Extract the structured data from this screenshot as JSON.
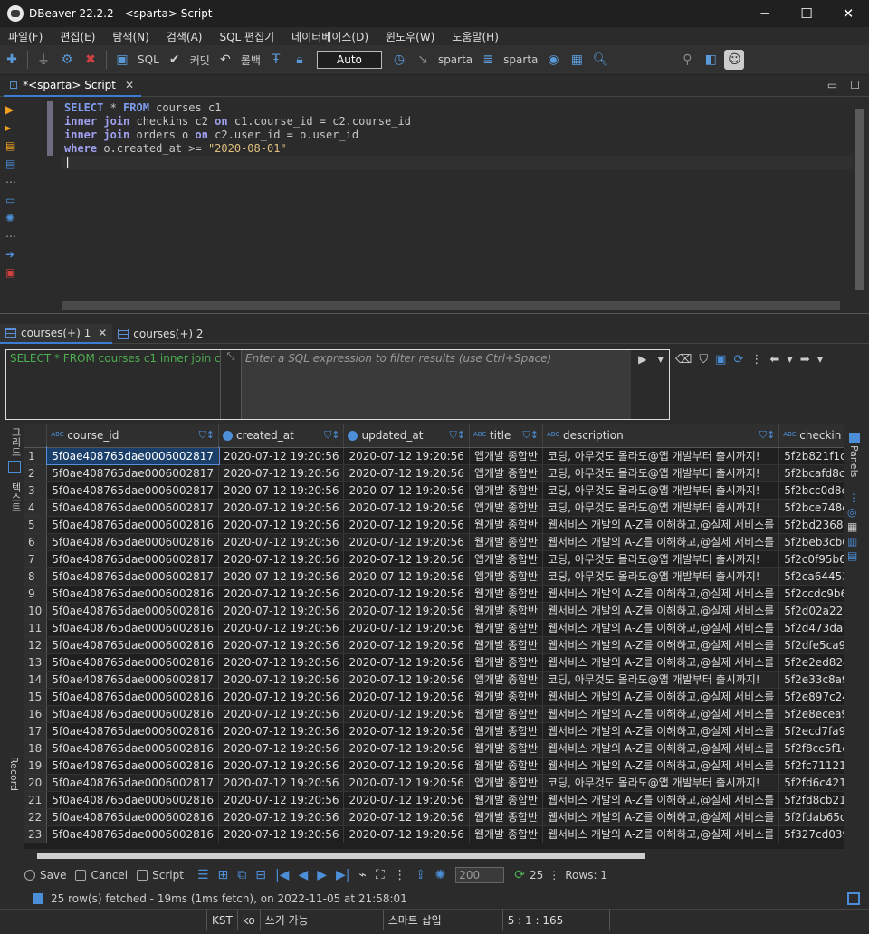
{
  "window": {
    "title": "DBeaver 22.2.2 - <sparta> Script",
    "minimize": "─",
    "maximize": "☐",
    "close": "✕"
  },
  "menu": [
    "파일(F)",
    "편집(E)",
    "탐색(N)",
    "검색(A)",
    "SQL 편집기",
    "데이터베이스(D)",
    "윈도우(W)",
    "도움말(H)"
  ],
  "toolbar": {
    "sql": "SQL",
    "commit": "커밋",
    "rollback": "롤백",
    "auto": "Auto",
    "datasource": "sparta",
    "schema": "sparta"
  },
  "editor_tab": {
    "label": "*<sparta> Script"
  },
  "sql": {
    "line1": [
      "SELECT",
      " * ",
      "FROM",
      " courses c1"
    ],
    "line2": [
      "inner join",
      " checkins c2 ",
      "on",
      " c1.course_id = c2.course_id"
    ],
    "line3": [
      "inner join",
      " orders o ",
      "on",
      " c2.user_id = o.user_id"
    ],
    "line4": [
      "where",
      " o.created_at >= ",
      "\"2020-08-01\""
    ]
  },
  "result_tabs": [
    {
      "label": "courses(+) 1"
    },
    {
      "label": "courses(+) 2"
    }
  ],
  "filter": {
    "query_preview": "SELECT * FROM courses c1 inner join c",
    "placeholder": "Enter a SQL expression to filter results (use Ctrl+Space)"
  },
  "side_left": {
    "grid": "그리드",
    "text": "텍스트",
    "record": "Record"
  },
  "side_right": {
    "panels": "Panels"
  },
  "columns": [
    {
      "name": "course_id",
      "icon": "ABC"
    },
    {
      "name": "created_at",
      "icon": "clock"
    },
    {
      "name": "updated_at",
      "icon": "clock"
    },
    {
      "name": "title",
      "icon": "ABC"
    },
    {
      "name": "description",
      "icon": "ABC"
    },
    {
      "name": "checkin",
      "icon": "ABC"
    }
  ],
  "rows": [
    [
      "1",
      "5f0ae408765dae0006002817",
      "2020-07-12 19:20:56",
      "2020-07-12 19:20:56",
      "앱개발 종합반",
      "코딩, 아무것도 몰라도@앱 개발부터 출시까지!",
      "5f2b821f1c"
    ],
    [
      "2",
      "5f0ae408765dae0006002817",
      "2020-07-12 19:20:56",
      "2020-07-12 19:20:56",
      "앱개발 종합반",
      "코딩, 아무것도 몰라도@앱 개발부터 출시까지!",
      "5f2bcafd8c"
    ],
    [
      "3",
      "5f0ae408765dae0006002817",
      "2020-07-12 19:20:56",
      "2020-07-12 19:20:56",
      "앱개발 종합반",
      "코딩, 아무것도 몰라도@앱 개발부터 출시까지!",
      "5f2bcc0d8c"
    ],
    [
      "4",
      "5f0ae408765dae0006002817",
      "2020-07-12 19:20:56",
      "2020-07-12 19:20:56",
      "앱개발 종합반",
      "코딩, 아무것도 몰라도@앱 개발부터 출시까지!",
      "5f2bce748c"
    ],
    [
      "5",
      "5f0ae408765dae0006002816",
      "2020-07-12 19:20:56",
      "2020-07-12 19:20:56",
      "웹개발 종합반",
      "웹서비스 개발의 A-Z를 이해하고,@실제 서비스를",
      "5f2bd2368c"
    ],
    [
      "6",
      "5f0ae408765dae0006002816",
      "2020-07-12 19:20:56",
      "2020-07-12 19:20:56",
      "웹개발 종합반",
      "웹서비스 개발의 A-Z를 이해하고,@실제 서비스를",
      "5f2beb3cb6"
    ],
    [
      "7",
      "5f0ae408765dae0006002817",
      "2020-07-12 19:20:56",
      "2020-07-12 19:20:56",
      "앱개발 종합반",
      "코딩, 아무것도 몰라도@앱 개발부터 출시까지!",
      "5f2c0f95b6"
    ],
    [
      "8",
      "5f0ae408765dae0006002817",
      "2020-07-12 19:20:56",
      "2020-07-12 19:20:56",
      "앱개발 종합반",
      "코딩, 아무것도 몰라도@앱 개발부터 출시까지!",
      "5f2ca64453"
    ],
    [
      "9",
      "5f0ae408765dae0006002816",
      "2020-07-12 19:20:56",
      "2020-07-12 19:20:56",
      "웹개발 종합반",
      "웹서비스 개발의 A-Z를 이해하고,@실제 서비스를",
      "5f2ccdc9b6"
    ],
    [
      "10",
      "5f0ae408765dae0006002816",
      "2020-07-12 19:20:56",
      "2020-07-12 19:20:56",
      "웹개발 종합반",
      "웹서비스 개발의 A-Z를 이해하고,@실제 서비스를",
      "5f2d02a22a"
    ],
    [
      "11",
      "5f0ae408765dae0006002816",
      "2020-07-12 19:20:56",
      "2020-07-12 19:20:56",
      "웹개발 종합반",
      "웹서비스 개발의 A-Z를 이해하고,@실제 서비스를",
      "5f2d473da9"
    ],
    [
      "12",
      "5f0ae408765dae0006002816",
      "2020-07-12 19:20:56",
      "2020-07-12 19:20:56",
      "웹개발 종합반",
      "웹서비스 개발의 A-Z를 이해하고,@실제 서비스를",
      "5f2dfe5ca9"
    ],
    [
      "13",
      "5f0ae408765dae0006002816",
      "2020-07-12 19:20:56",
      "2020-07-12 19:20:56",
      "웹개발 종합반",
      "웹서비스 개발의 A-Z를 이해하고,@실제 서비스를",
      "5f2e2ed824"
    ],
    [
      "14",
      "5f0ae408765dae0006002817",
      "2020-07-12 19:20:56",
      "2020-07-12 19:20:56",
      "앱개발 종합반",
      "코딩, 아무것도 몰라도@앱 개발부터 출시까지!",
      "5f2e33c8a9"
    ],
    [
      "15",
      "5f0ae408765dae0006002816",
      "2020-07-12 19:20:56",
      "2020-07-12 19:20:56",
      "웹개발 종합반",
      "웹서비스 개발의 A-Z를 이해하고,@실제 서비스를",
      "5f2e897c24"
    ],
    [
      "16",
      "5f0ae408765dae0006002816",
      "2020-07-12 19:20:56",
      "2020-07-12 19:20:56",
      "웹개발 종합반",
      "웹서비스 개발의 A-Z를 이해하고,@실제 서비스를",
      "5f2e8ecea9"
    ],
    [
      "17",
      "5f0ae408765dae0006002816",
      "2020-07-12 19:20:56",
      "2020-07-12 19:20:56",
      "웹개발 종합반",
      "웹서비스 개발의 A-Z를 이해하고,@실제 서비스를",
      "5f2ecd7fa9"
    ],
    [
      "18",
      "5f0ae408765dae0006002816",
      "2020-07-12 19:20:56",
      "2020-07-12 19:20:56",
      "웹개발 종합반",
      "웹서비스 개발의 A-Z를 이해하고,@실제 서비스를",
      "5f2f8cc5f1e"
    ],
    [
      "19",
      "5f0ae408765dae0006002816",
      "2020-07-12 19:20:56",
      "2020-07-12 19:20:56",
      "웹개발 종합반",
      "웹서비스 개발의 A-Z를 이해하고,@실제 서비스를",
      "5f2fc71121"
    ],
    [
      "20",
      "5f0ae408765dae0006002817",
      "2020-07-12 19:20:56",
      "2020-07-12 19:20:56",
      "앱개발 종합반",
      "코딩, 아무것도 몰라도@앱 개발부터 출시까지!",
      "5f2fd6c421"
    ],
    [
      "21",
      "5f0ae408765dae0006002816",
      "2020-07-12 19:20:56",
      "2020-07-12 19:20:56",
      "웹개발 종합반",
      "웹서비스 개발의 A-Z를 이해하고,@실제 서비스를",
      "5f2fd8cb21"
    ],
    [
      "22",
      "5f0ae408765dae0006002816",
      "2020-07-12 19:20:56",
      "2020-07-12 19:20:56",
      "웹개발 종합반",
      "웹서비스 개발의 A-Z를 이해하고,@실제 서비스를",
      "5f2fdab65d"
    ],
    [
      "23",
      "5f0ae408765dae0006002816",
      "2020-07-12 19:20:56",
      "2020-07-12 19:20:56",
      "웹개발 종합반",
      "웹서비스 개발의 A-Z를 이해하고,@실제 서비스를",
      "5f327cd039"
    ]
  ],
  "bottom": {
    "save": "Save",
    "cancel": "Cancel",
    "script": "Script",
    "limit": "200",
    "count": "25",
    "rows": "Rows: 1"
  },
  "fetch": "25 row(s) fetched - 19ms (1ms fetch), on 2022-11-05 at 21:58:01",
  "status": {
    "tz": "KST",
    "lang": "ko",
    "mode": "쓰기 가능",
    "insert": "스마트 삽입",
    "pos": "5 : 1 : 165"
  },
  "colors": {
    "keyword": "#a0a0f0",
    "string": "#e0c080",
    "selection": "#1a3f6b",
    "accent": "#3d7cd4"
  }
}
